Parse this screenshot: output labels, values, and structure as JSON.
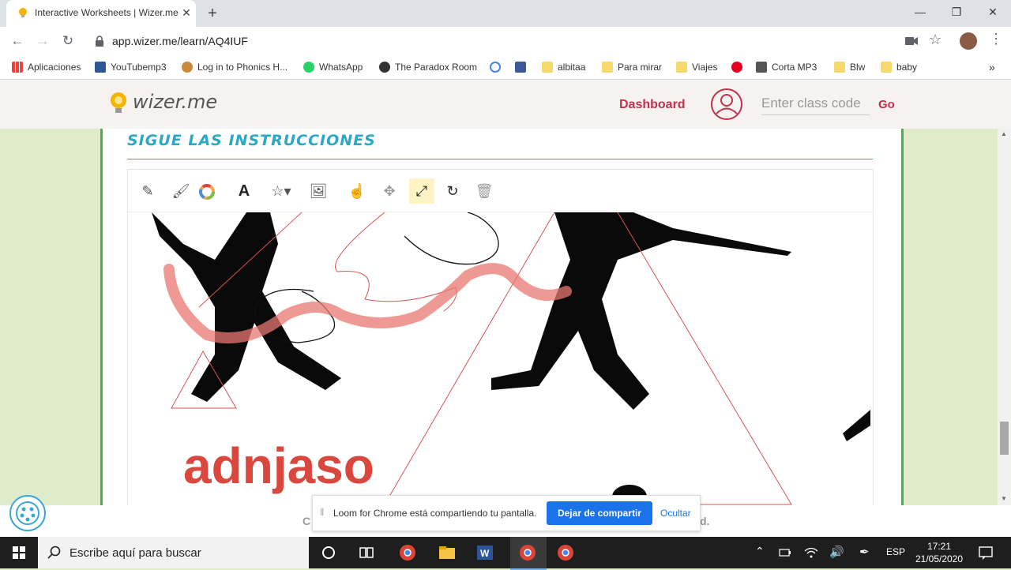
{
  "browser": {
    "tab_title": "Interactive Worksheets | Wizer.me",
    "url": "app.wizer.me/learn/AQ4IUF",
    "bookmarks": [
      {
        "label": "Aplicaciones",
        "color": "#e8453c"
      },
      {
        "label": "YouTubemp3",
        "color": "#2b5797"
      },
      {
        "label": "Log in to Phonics H...",
        "color": "#c98a3c"
      },
      {
        "label": "WhatsApp",
        "color": "#25d366"
      },
      {
        "label": "The Paradox Room",
        "color": "#333333"
      },
      {
        "label": "",
        "color": "#4285f4"
      },
      {
        "label": "",
        "color": "#3b5998"
      },
      {
        "label": "albitaa",
        "color": "#f6d86b"
      },
      {
        "label": "Para mirar",
        "color": "#f6d86b"
      },
      {
        "label": "Viajes",
        "color": "#f6d86b"
      },
      {
        "label": "",
        "color": "#e60023"
      },
      {
        "label": "Corta MP3",
        "color": "#555555"
      },
      {
        "label": "Blw",
        "color": "#f6d86b"
      },
      {
        "label": "baby",
        "color": "#f6d86b"
      }
    ]
  },
  "wizer": {
    "logo": "wizer.me",
    "dashboard": "Dashboard",
    "class_code_placeholder": "Enter class code",
    "go": "Go"
  },
  "worksheet": {
    "heading": "SIGUE LAS INSTRUCCIONES",
    "canvas_text": "adnjaso"
  },
  "loom": {
    "message": "Loom for Chrome está compartiendo tu pantalla.",
    "stop": "Dejar de compartir",
    "hide": "Ocultar",
    "behind_left": "C",
    "behind_right": "d."
  },
  "taskbar": {
    "search_placeholder": "Escribe aquí para buscar",
    "language": "ESP",
    "time": "17:21",
    "date": "21/05/2020"
  },
  "colors": {
    "accent_red": "#c0314d",
    "heading_teal": "#2aa8c4",
    "card_border": "#4cae4c",
    "brush_red": "#e8776f"
  }
}
